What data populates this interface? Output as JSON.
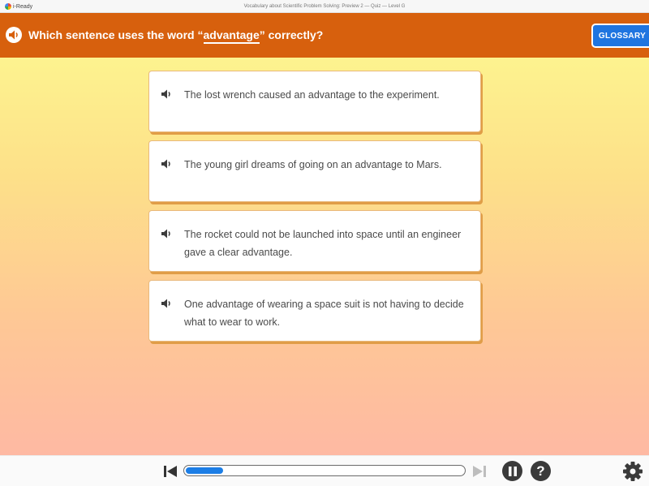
{
  "titlebar": {
    "app_name": "i-Ready",
    "window_title": "Vocabulary about Scientific Problem Solving: Preview 2 — Quiz — Level G"
  },
  "header": {
    "question_prefix": "Which sentence uses the word “",
    "keyword": "advantage",
    "question_suffix": "” correctly?",
    "glossary_label": "GLOSSARY",
    "speaker_icon": "speaker-icon"
  },
  "options": [
    {
      "text": "The lost wrench caused an advantage to the experiment."
    },
    {
      "text": "The young girl dreams of going on an advantage to Mars."
    },
    {
      "text": "The rocket could not be launched into space until an engineer gave a clear advantage."
    },
    {
      "text": "One advantage of wearing a space suit is not having to decide what to wear to work."
    }
  ],
  "bottombar": {
    "progress_fraction": 0.14,
    "help_label": "?",
    "icons": [
      "skip-back-icon",
      "skip-forward-icon",
      "pause-icon",
      "help-icon",
      "gear-icon"
    ]
  },
  "colors": {
    "header_bg": "#d7600d",
    "glossary_bg": "#1f75e0",
    "progress_fill": "#1c7ee6",
    "option_border": "#e9b97c"
  }
}
